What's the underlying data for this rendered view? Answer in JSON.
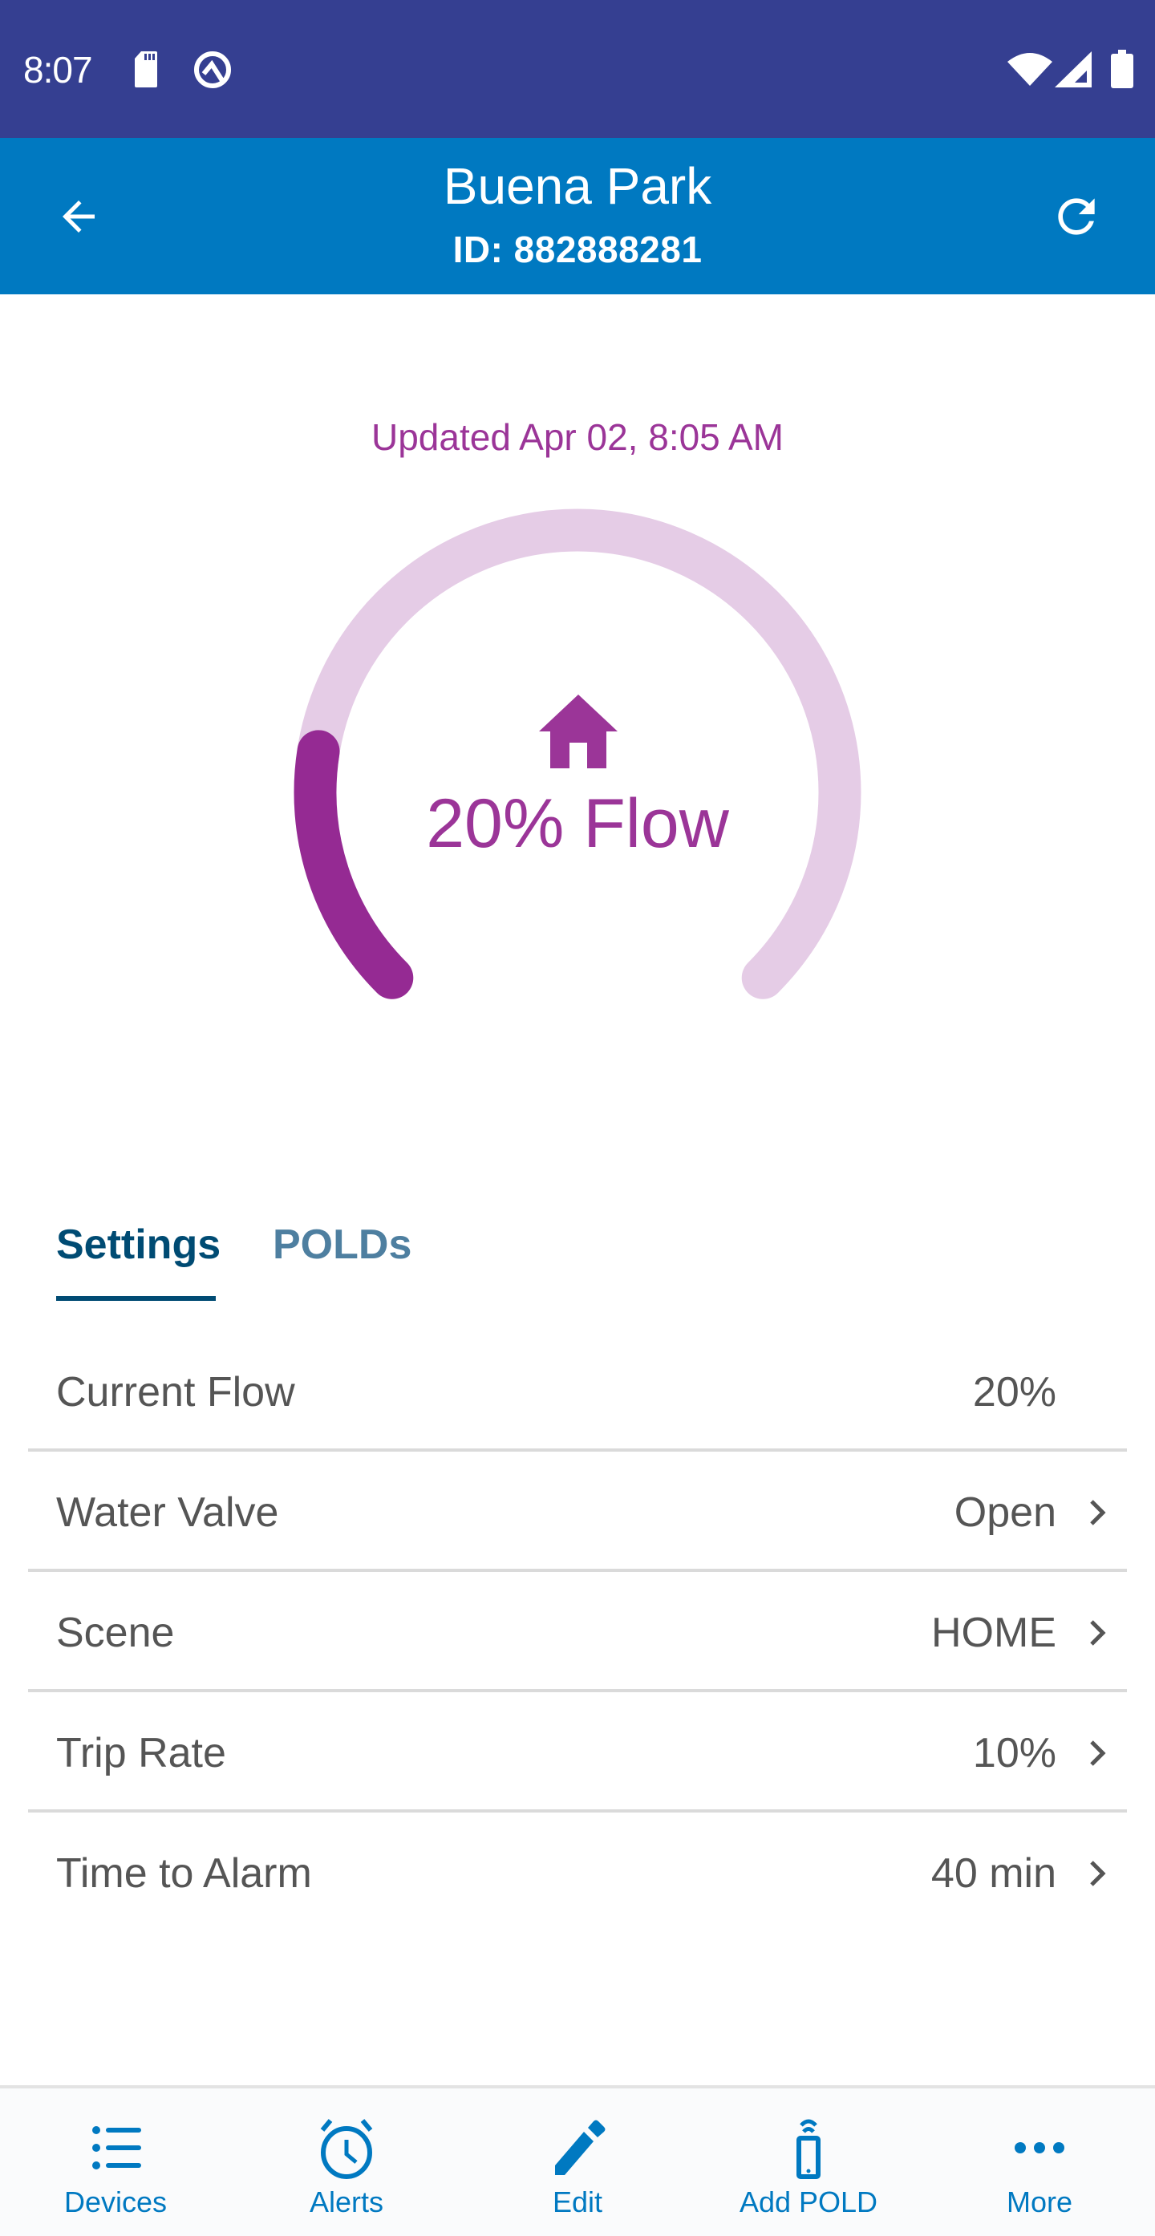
{
  "status_bar": {
    "time": "8:07",
    "icons": [
      "sd-card-icon",
      "q-circle-icon",
      "wifi-icon",
      "cell-signal-icon",
      "battery-icon"
    ]
  },
  "header": {
    "title": "Buena Park",
    "subtitle": "ID: 882888281",
    "back_icon": "arrow-left-icon",
    "refresh_icon": "refresh-icon"
  },
  "gauge": {
    "updated_text": "Updated Apr 02, 8:05 AM",
    "value_percent": 20,
    "label": "20% Flow",
    "scene_icon": "home-icon",
    "colors": {
      "fill": "#952A93",
      "track": "#E5CCE6",
      "text": "#9B3598"
    }
  },
  "tabs": [
    {
      "label": "Settings",
      "active": true
    },
    {
      "label": "POLDs",
      "active": false
    }
  ],
  "settings": [
    {
      "label": "Current Flow",
      "value": "20%",
      "has_chevron": false
    },
    {
      "label": "Water Valve",
      "value": "Open",
      "has_chevron": true
    },
    {
      "label": "Scene",
      "value": "HOME",
      "has_chevron": true
    },
    {
      "label": "Trip Rate",
      "value": "10%",
      "has_chevron": true
    },
    {
      "label": "Time to Alarm",
      "value": "40 min",
      "has_chevron": true
    }
  ],
  "bottom_nav": [
    {
      "label": "Devices",
      "icon": "list-icon"
    },
    {
      "label": "Alerts",
      "icon": "alarm-clock-icon"
    },
    {
      "label": "Edit",
      "icon": "pencil-icon"
    },
    {
      "label": "Add POLD",
      "icon": "phone-signal-icon"
    },
    {
      "label": "More",
      "icon": "more-dots-icon"
    }
  ],
  "colors": {
    "status_bar": "#353F91",
    "header": "#0079C1",
    "tab_active": "#004B73",
    "tab_inactive": "#4E7FA0",
    "nav_accent": "#0079C1"
  }
}
